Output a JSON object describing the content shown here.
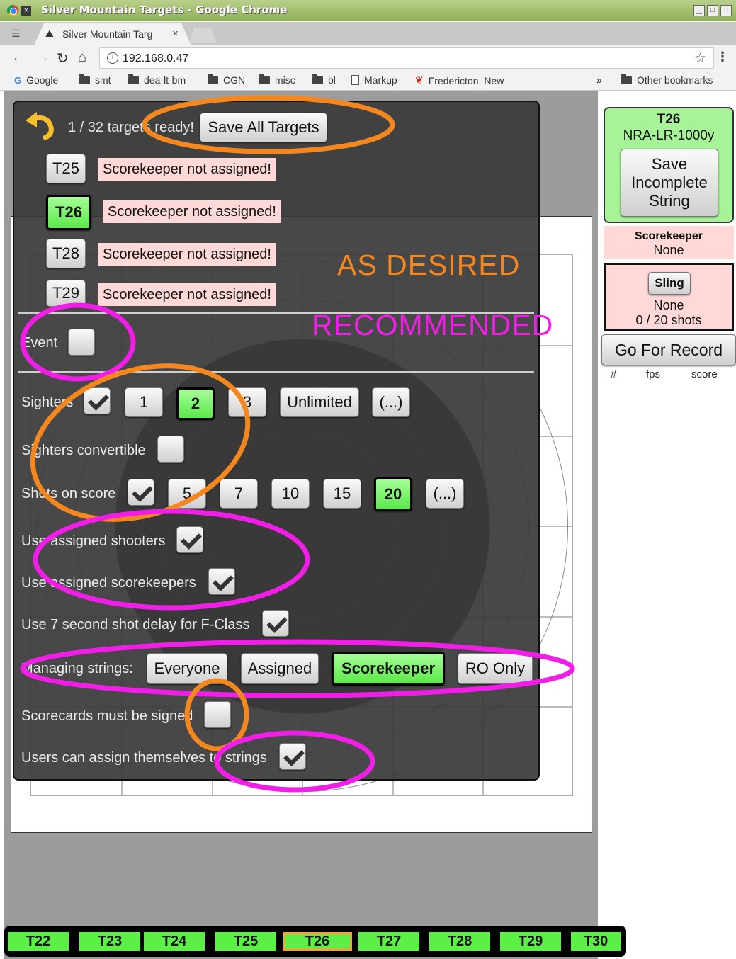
{
  "window": {
    "title": "Silver Mountain Targets - Google Chrome"
  },
  "tab": {
    "title": "Silver Mountain Targ",
    "close": "×"
  },
  "toolbar": {
    "url": "192.168.0.47"
  },
  "bookmarks": {
    "items": [
      {
        "label": "Google",
        "icon": "google-icon"
      },
      {
        "label": "smt",
        "icon": "folder-icon"
      },
      {
        "label": "dea-lt-bm",
        "icon": "folder-icon"
      },
      {
        "label": "CGN",
        "icon": "folder-icon"
      },
      {
        "label": "misc",
        "icon": "folder-icon"
      },
      {
        "label": "bl",
        "icon": "folder-icon"
      },
      {
        "label": "Markup",
        "icon": "page-icon"
      },
      {
        "label": "Fredericton, New",
        "icon": "maple-leaf-icon"
      }
    ],
    "overflow": "»",
    "other": "Other bookmarks"
  },
  "panel": {
    "ready_text": "1 / 32 targets ready!",
    "save_all": "Save All Targets",
    "targets": [
      {
        "label": "T25",
        "warning": "Scorekeeper not assigned!",
        "active": false
      },
      {
        "label": "T26",
        "warning": "Scorekeeper not assigned!",
        "active": true
      },
      {
        "label": "T28",
        "warning": "Scorekeeper not assigned!",
        "active": false
      },
      {
        "label": "T29",
        "warning": "Scorekeeper not assigned!",
        "active": false
      }
    ],
    "event_label": "Event",
    "sighters_label": "Sighters",
    "sighter_options": [
      "1",
      "2",
      "3",
      "Unlimited",
      "(...)"
    ],
    "sighter_selected": "2",
    "sighters_convertible_label": "Sighters convertible",
    "shots_label": "Shots on score",
    "shot_options": [
      "5",
      "7",
      "10",
      "15",
      "20",
      "(...)"
    ],
    "shot_selected": "20",
    "assigned_shooters_label": "Use assigned shooters",
    "assigned_scorekeepers_label": "Use assigned scorekeepers",
    "delay_label": "Use 7 second shot delay for F-Class",
    "managing_label": "Managing strings:",
    "managing_options": [
      "Everyone",
      "Assigned",
      "Scorekeeper",
      "RO Only"
    ],
    "managing_selected": "Scorekeeper",
    "signed_label": "Scorecards must be signed",
    "self_assign_label": "Users can assign themselves to strings"
  },
  "annotations": {
    "as_desired": "AS DESIRED",
    "recommended": "RECOMMENDED",
    "orange": "#f5871f",
    "magenta": "#f01ee6"
  },
  "sidebar": {
    "target_id": "T26",
    "target_type": "NRA-LR-1000y",
    "save_incomplete": "Save Incomplete String",
    "scorekeeper_header": "Scorekeeper",
    "scorekeeper_value": "None",
    "sling_button": "Sling",
    "sling_value": "None",
    "shots": "0 / 20 shots",
    "go_for_record": "Go For Record",
    "col_num": "#",
    "col_fps": "fps",
    "col_score": "score"
  },
  "target_tabs": [
    "T22",
    "T23",
    "T24",
    "T25",
    "T26",
    "T27",
    "T28",
    "T29",
    "T30"
  ],
  "target_tabs_active": "T26",
  "colors": {
    "accent_green": "#5cf046",
    "warning_pink": "#ffd8d8",
    "panel_dark": "#3a3a3a"
  }
}
